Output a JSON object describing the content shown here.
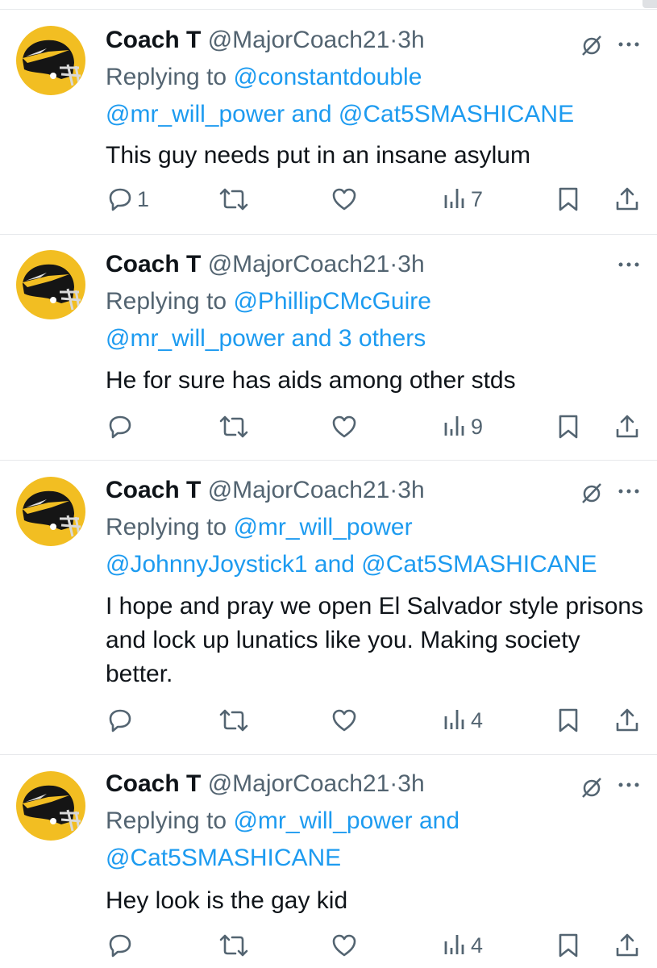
{
  "tweets": [
    {
      "name": "Coach T",
      "handle": "@MajorCoach21",
      "sep": "·",
      "time": "3h",
      "reply_prefix": "Replying to ",
      "reply_line1_link": "@constantdouble",
      "reply_line1_rest": "",
      "reply_line2": "@mr_will_power and @Cat5SMASHICANE",
      "text": "This guy needs put in an insane asylum",
      "reply_count": "1",
      "view_count": "7",
      "muted": true
    },
    {
      "name": "Coach T",
      "handle": "@MajorCoach21",
      "sep": "·",
      "time": "3h",
      "reply_prefix": "Replying to ",
      "reply_line1_link": "@PhillipCMcGuire",
      "reply_line1_rest": "",
      "reply_line2": "@mr_will_power and 3 others",
      "text": "He for sure has aids among other stds",
      "reply_count": "",
      "view_count": "9",
      "muted": false
    },
    {
      "name": "Coach T",
      "handle": "@MajorCoach21",
      "sep": "·",
      "time": "3h",
      "reply_prefix": "Replying to ",
      "reply_line1_link": "@mr_will_power",
      "reply_line1_rest": "",
      "reply_line2": "@JohnnyJoystick1 and @Cat5SMASHICANE",
      "text": "I hope and pray we open El Salvador style prisons and lock up lunatics like you. Making society better.",
      "reply_count": "",
      "view_count": "4",
      "muted": true
    },
    {
      "name": "Coach T",
      "handle": "@MajorCoach21",
      "sep": "·",
      "time": "3h",
      "reply_prefix": "Replying to ",
      "reply_line1_link": "@mr_will_power and",
      "reply_line1_rest": "",
      "reply_line2": "@Cat5SMASHICANE",
      "text": "Hey look is the gay kid",
      "reply_count": "",
      "view_count": "4",
      "muted": true
    }
  ],
  "icons": {
    "reply": "reply-icon",
    "retweet": "retweet-icon",
    "like": "like-heart-icon",
    "views": "views-bar-chart-icon",
    "bookmark": "bookmark-icon",
    "share": "share-icon",
    "mute": "muted-conversation-icon",
    "more": "more-dots-icon",
    "avatar": "football-helmet-avatar"
  },
  "colors": {
    "link": "#1d9bf0",
    "secondary_text": "#536471",
    "primary_text": "#0f1419",
    "avatar_bg": "#f2be22",
    "divider": "#e6e8eb"
  }
}
